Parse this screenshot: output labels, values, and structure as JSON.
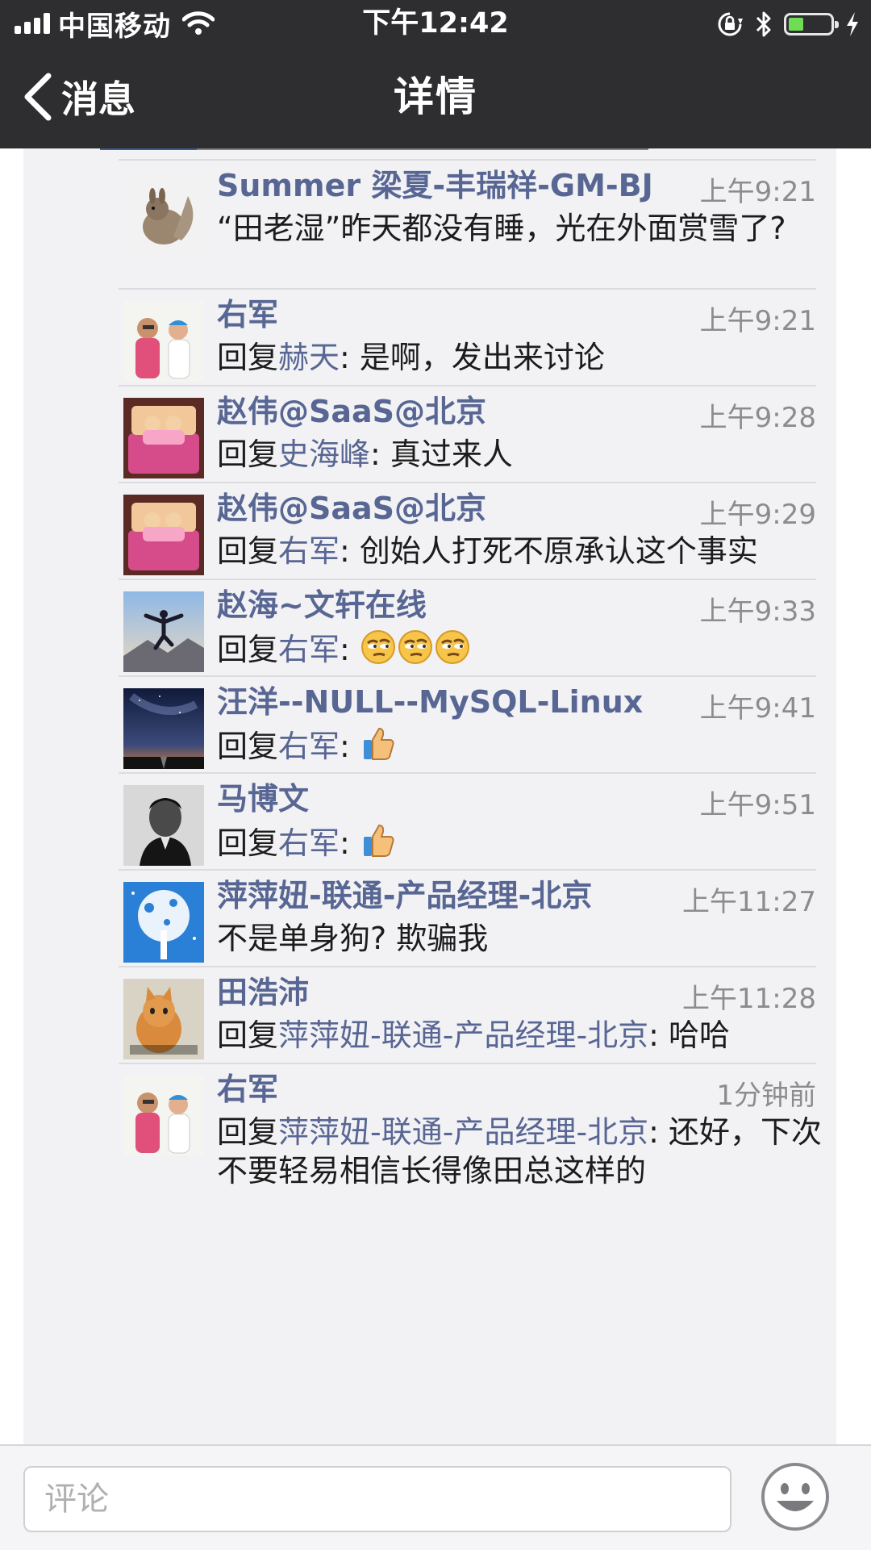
{
  "status_bar": {
    "carrier": "中国移动",
    "time": "下午12:42"
  },
  "nav": {
    "back_label": "消息",
    "title": "详情"
  },
  "comments": [
    {
      "name": "Summer 梁夏-丰瑞祥-GM-BJ",
      "time": "上午9:21",
      "reply_prefix": "",
      "reply_to": "",
      "separator": "",
      "text": "“田老湿”昨天都没有睡，光在外面赏雪了?",
      "emoji": [],
      "avatar": "squirrel-avatar"
    },
    {
      "name": "右军",
      "time": "上午9:21",
      "reply_prefix": "回复",
      "reply_to": "赫天",
      "separator": ": ",
      "text": "是啊，发出来讨论",
      "emoji": [],
      "avatar": "kids-avatar"
    },
    {
      "name": "赵伟@SaaS@北京",
      "time": "上午9:28",
      "reply_prefix": "回复",
      "reply_to": "史海峰",
      "separator": ": ",
      "text": "真过来人",
      "emoji": [],
      "avatar": "cartoon-bed-avatar"
    },
    {
      "name": "赵伟@SaaS@北京",
      "time": "上午9:29",
      "reply_prefix": "回复",
      "reply_to": "右军",
      "separator": ": ",
      "text": "创始人打死不原承认这个事实",
      "emoji": [],
      "avatar": "cartoon-bed-avatar"
    },
    {
      "name": "赵海~文轩在线",
      "time": "上午9:33",
      "reply_prefix": "回复",
      "reply_to": "右军",
      "separator": ": ",
      "text": "",
      "emoji": [
        "thinking-face-emoji",
        "thinking-face-emoji",
        "thinking-face-emoji"
      ],
      "avatar": "jumping-man-avatar"
    },
    {
      "name": "汪洋--NULL--MySQL-Linux",
      "time": "上午9:41",
      "reply_prefix": "回复",
      "reply_to": "右军",
      "separator": ": ",
      "text": "",
      "emoji": [
        "thumbs-up-emoji"
      ],
      "avatar": "night-sky-avatar"
    },
    {
      "name": "马博文",
      "time": "上午9:51",
      "reply_prefix": "回复",
      "reply_to": "右军",
      "separator": ": ",
      "text": "",
      "emoji": [
        "thumbs-up-emoji"
      ],
      "avatar": "portrait-bw-avatar"
    },
    {
      "name": "萍萍妞-联通-产品经理-北京",
      "time": "上午11:27",
      "reply_prefix": "",
      "reply_to": "",
      "separator": "",
      "text": "不是单身狗? 欺骗我",
      "emoji": [],
      "avatar": "snow-tree-avatar"
    },
    {
      "name": "田浩沛",
      "time": "上午11:28",
      "reply_prefix": "回复",
      "reply_to": "萍萍妞-联通-产品经理-北京",
      "separator": ": ",
      "text": "哈哈",
      "emoji": [],
      "avatar": "cat-avatar"
    },
    {
      "name": "右军",
      "time": "1分钟前",
      "reply_prefix": "回复",
      "reply_to": "萍萍妞-联通-产品经理-北京",
      "separator": ": ",
      "text": "还好，下次不要轻易相信长得像田总这样的",
      "emoji": [],
      "avatar": "kids-avatar"
    }
  ],
  "comment_bar": {
    "placeholder": "评论"
  }
}
